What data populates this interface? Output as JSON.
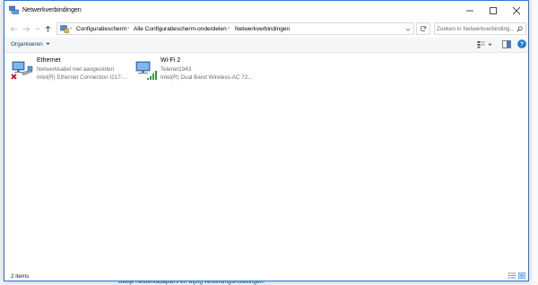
{
  "window": {
    "title": "Netwerkverbindingen"
  },
  "address": {
    "breadcrumbs": [
      "Configuratiescherm",
      "Alle Configuratiescherm-onderdelen",
      "Netwerkverbindingen"
    ]
  },
  "search": {
    "placeholder": "Zoeken in Netwerkverbinding..."
  },
  "toolbar": {
    "organize_label": "Organiseren"
  },
  "items": [
    {
      "name": "Ethernet",
      "status": "Netwerkkabel niet aangesloten",
      "device": "Intel(R) Ethernet Connection I217-...",
      "icon": "ethernet-disconnected-icon"
    },
    {
      "name": "Wi-Fi 2",
      "status": "Telenet1943",
      "device": "Intel(R) Dual Band Wireless-AC 72...",
      "icon": "wifi-connected-icon"
    }
  ],
  "statusbar": {
    "item_count": "2 items"
  },
  "background": {
    "footer_text": "Bekijk netwerkadapters en wijzig verbindingsinstellingen."
  },
  "colors": {
    "accent": "#2b79d7",
    "help": "#1979ca",
    "signal": "#2e9e2e",
    "error": "#d0021b"
  }
}
